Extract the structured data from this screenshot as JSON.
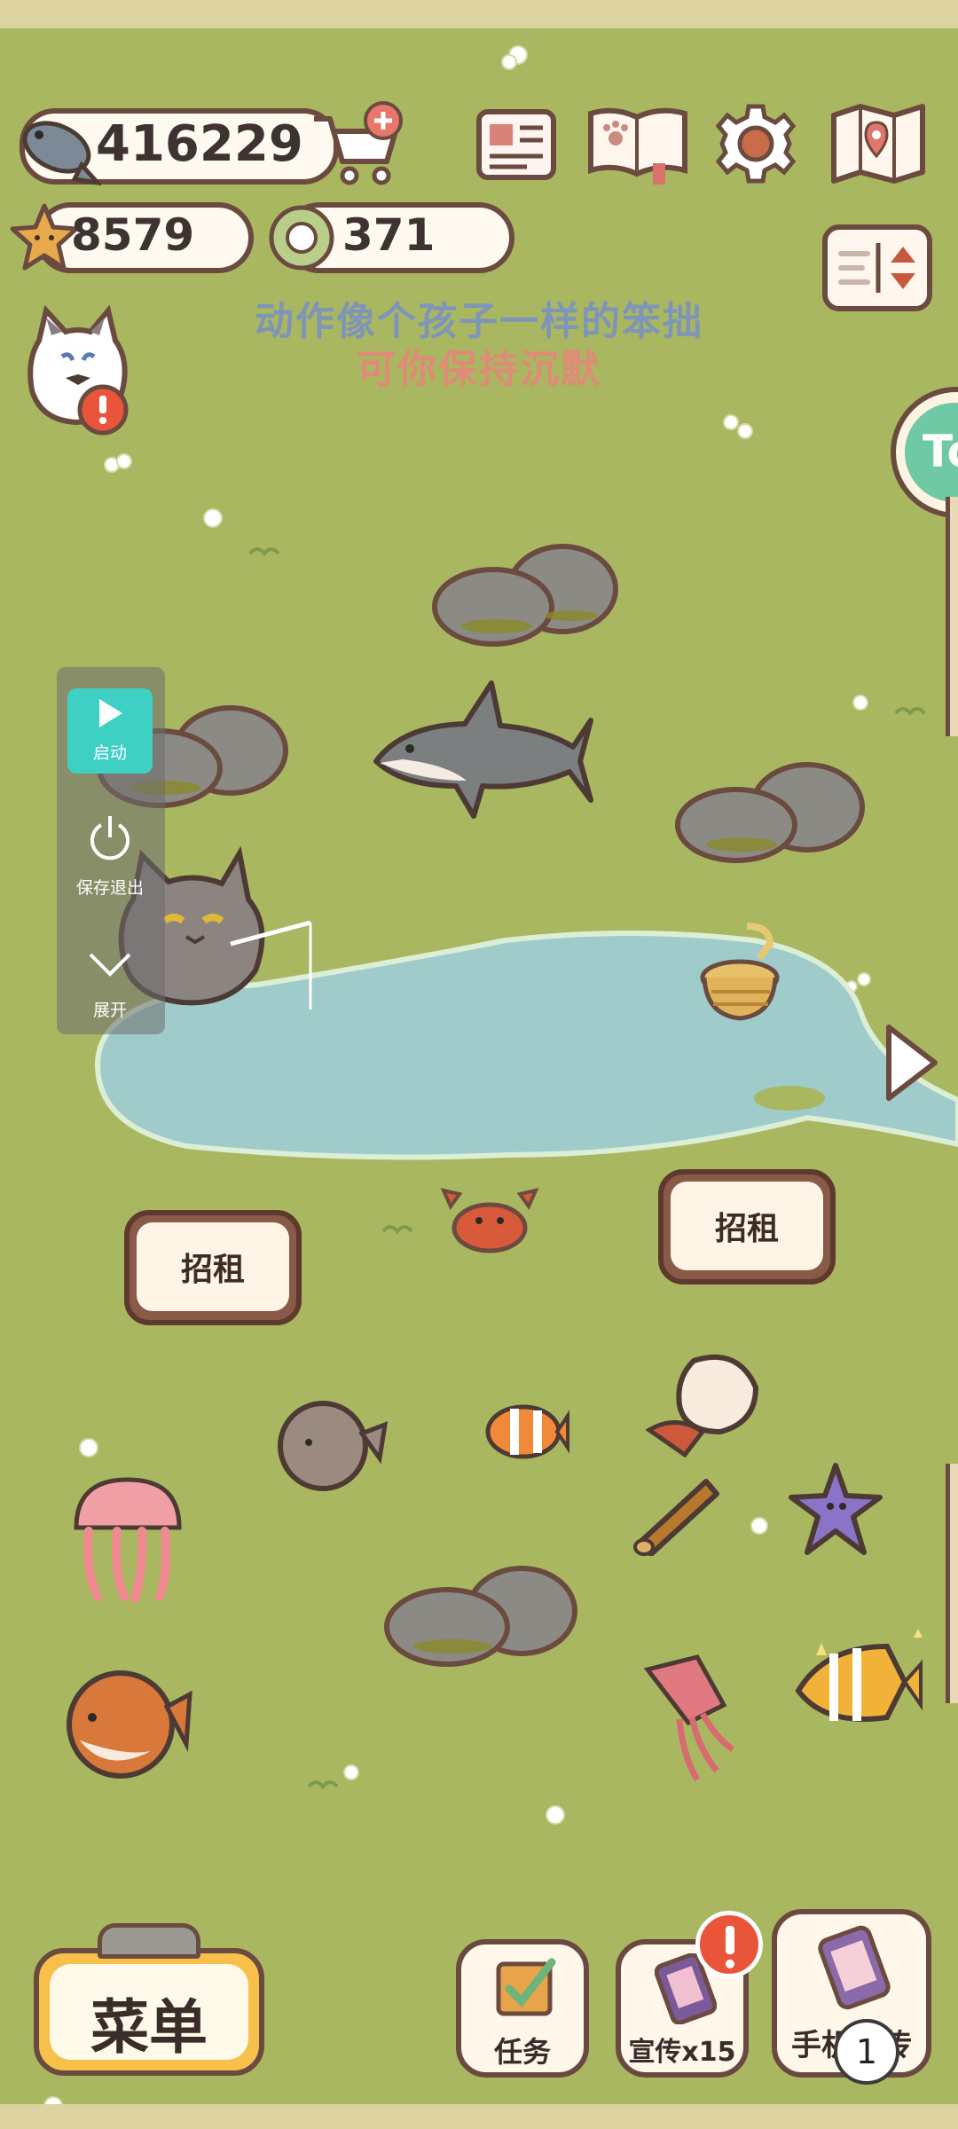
{
  "currency": {
    "fish": "416229",
    "stars": "8579",
    "rings": "371"
  },
  "lyrics": {
    "line1": "动作像个孩子一样的笨拙",
    "line2": "可你保持沉默"
  },
  "side_tab_label": "To",
  "signs": {
    "left": "招租",
    "right": "招租"
  },
  "float_panel": {
    "start": "启动",
    "save_exit": "保存退出",
    "expand": "展开"
  },
  "bottom": {
    "menu": "菜单",
    "tasks": "任务",
    "promo": "宣传x15",
    "phone": "手机宣传",
    "page_badge": "1"
  },
  "colors": {
    "grass": "#a8b760",
    "pond": "#9fcccb",
    "outline": "#6b4a3f",
    "alert": "#e8553a"
  }
}
